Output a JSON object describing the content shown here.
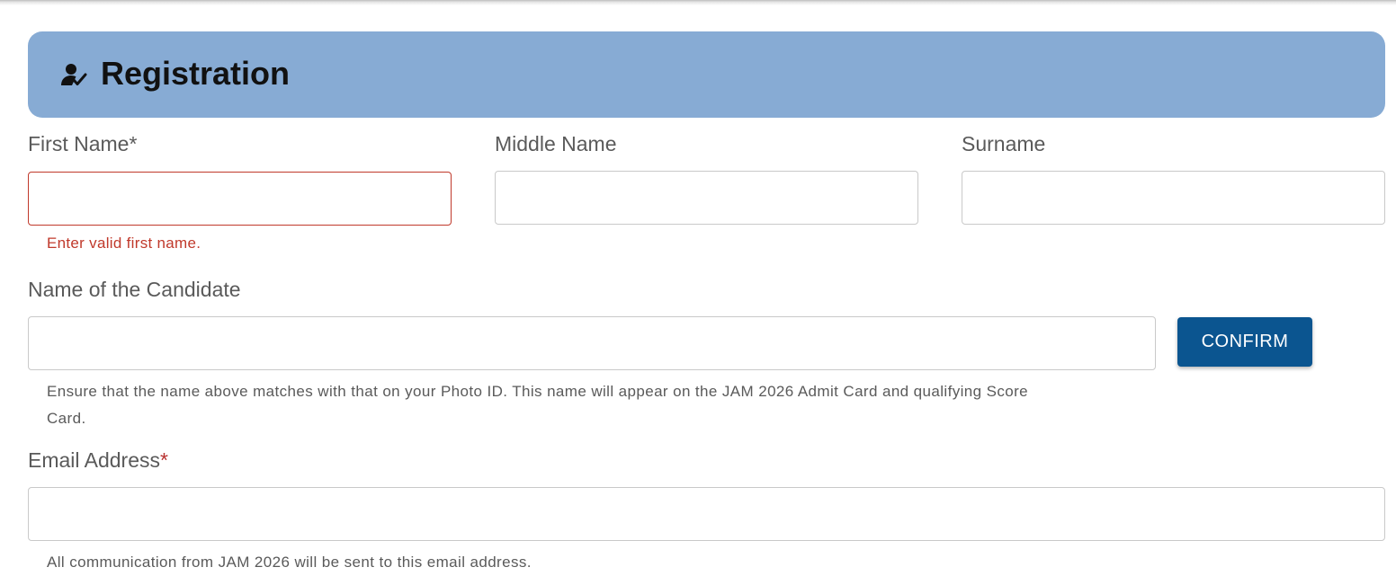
{
  "header": {
    "icon": "user-check-icon",
    "title": "Registration",
    "background": "#87abd4"
  },
  "form": {
    "first_name": {
      "label": "First Name",
      "required_marker": "*",
      "value": "",
      "error": "Enter valid first name."
    },
    "middle_name": {
      "label": "Middle Name",
      "value": ""
    },
    "surname": {
      "label": "Surname",
      "value": ""
    },
    "candidate_name": {
      "label": "Name of the Candidate",
      "value": "",
      "confirm_label": "CONFIRM",
      "help_line1": "Ensure that the name above matches with that on your Photo ID. This name will appear on the JAM 2026 Admit Card and qualifying Score",
      "help_line2": "Card."
    },
    "email": {
      "label": "Email Address",
      "required_marker": "*",
      "value": "",
      "help": "All communication from JAM 2026 will be sent to this email address."
    }
  },
  "colors": {
    "primary_button": "#0b5590",
    "error": "#c0392b",
    "label": "#5a5a5a"
  }
}
